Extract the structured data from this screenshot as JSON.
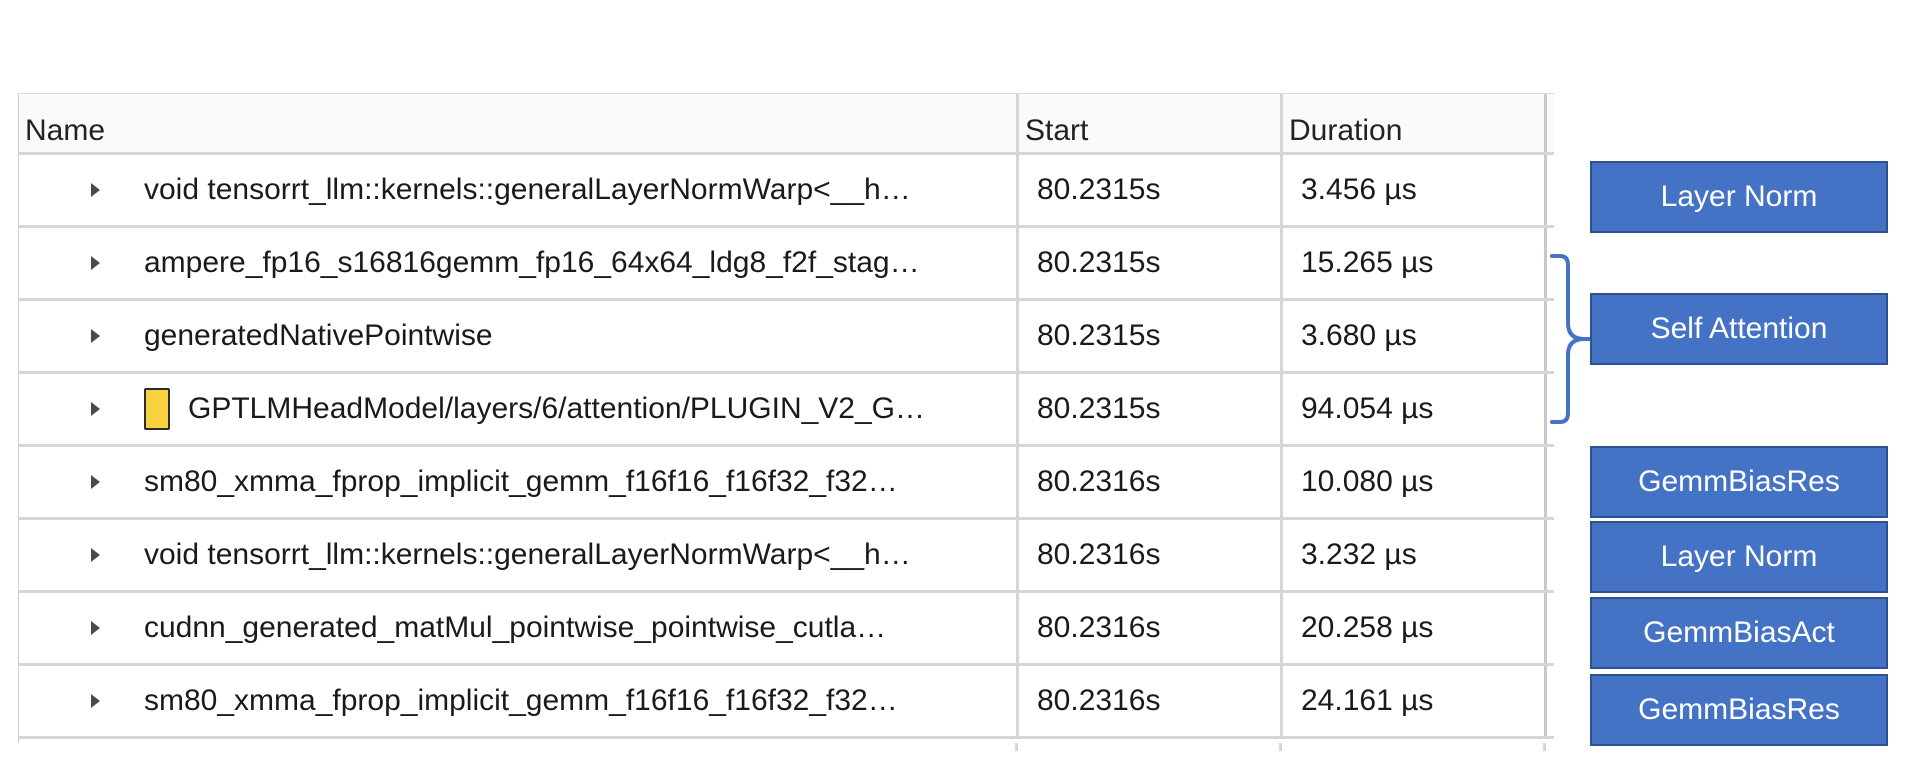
{
  "table": {
    "headers": {
      "name": "Name",
      "start": "Start",
      "duration": "Duration"
    },
    "rows": [
      {
        "name": "void tensorrt_llm::kernels::generalLayerNormWarp<__h…",
        "start": "80.2315s",
        "duration": "3.456 µs",
        "marker": false
      },
      {
        "name": "ampere_fp16_s16816gemm_fp16_64x64_ldg8_f2f_stag…",
        "start": "80.2315s",
        "duration": "15.265 µs",
        "marker": false
      },
      {
        "name": "generatedNativePointwise",
        "start": "80.2315s",
        "duration": "3.680 µs",
        "marker": false
      },
      {
        "name": "GPTLMHeadModel/layers/6/attention/PLUGIN_V2_G…",
        "start": "80.2315s",
        "duration": "94.054 µs",
        "marker": true,
        "marker_color": "#f7d23e"
      },
      {
        "name": "sm80_xmma_fprop_implicit_gemm_f16f16_f16f32_f32…",
        "start": "80.2316s",
        "duration": "10.080 µs",
        "marker": false
      },
      {
        "name": "void tensorrt_llm::kernels::generalLayerNormWarp<__h…",
        "start": "80.2316s",
        "duration": "3.232 µs",
        "marker": false
      },
      {
        "name": "cudnn_generated_matMul_pointwise_pointwise_cutla…",
        "start": "80.2316s",
        "duration": "20.258 µs",
        "marker": false
      },
      {
        "name": "sm80_xmma_fprop_implicit_gemm_f16f16_f16f32_f32…",
        "start": "80.2316s",
        "duration": "24.161 µs",
        "marker": false
      }
    ]
  },
  "annotations": {
    "layer_norm_1": "Layer Norm",
    "self_attention": "Self Attention",
    "gemm_bias_res_1": "GemmBiasRes",
    "layer_norm_2": "Layer Norm",
    "gemm_bias_act": "GemmBiasAct",
    "gemm_bias_res_2": "GemmBiasRes",
    "label_color": "#4472c4",
    "bracket_color": "#4472c4"
  },
  "icons": {
    "expand": "triangle-right-icon",
    "marker": "yellow-marker-icon",
    "bracket": "right-brace-icon"
  }
}
